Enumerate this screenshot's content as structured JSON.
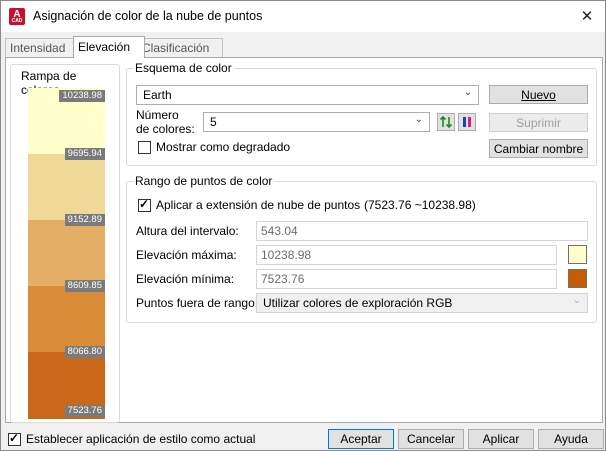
{
  "window": {
    "title": "Asignación de color de la nube de puntos",
    "app_icon_letter": "A",
    "app_icon_caption": "CAD",
    "close_glyph": "✕"
  },
  "tabs": [
    {
      "label": "Intensidad",
      "active": false
    },
    {
      "label": "Elevación",
      "active": true
    },
    {
      "label": "Clasificación",
      "active": false
    }
  ],
  "ramp": {
    "title": "Rampa de colores",
    "colors": [
      "#FFFFCC",
      "#F0D898",
      "#E4AE64",
      "#D88C38",
      "#C86818",
      "#C85C00"
    ],
    "labels": [
      "10238.98",
      "9695.94",
      "9152.89",
      "8609.85",
      "8066.80",
      "7523.76"
    ]
  },
  "color_scheme": {
    "title": "Esquema de color",
    "scheme_value": "Earth",
    "num_colors_label_1": "Número",
    "num_colors_label_2": "de colores:",
    "num_colors_value": "5",
    "show_gradient_label": "Mostrar como degradado",
    "show_gradient_checked": false,
    "new_button": "Nuevo",
    "delete_button": "Suprimir",
    "rename_button": "Cambiar nombre"
  },
  "point_range": {
    "title": "Rango de puntos de color",
    "apply_extent_label": "Aplicar a extensión de nube de puntos",
    "apply_extent_range": "(7523.76 ~10238.98)",
    "apply_extent_checked": true,
    "interval_label": "Altura del intervalo:",
    "interval_value": "543.04",
    "max_label": "Elevación máxima:",
    "max_value": "10238.98",
    "max_color": "#FFFFCC",
    "min_label": "Elevación mínima:",
    "min_value": "7523.76",
    "min_color": "#C85C00",
    "out_of_range_label": "Puntos fuera de rango:",
    "out_of_range_value": "Utilizar colores de exploración RGB"
  },
  "footer": {
    "set_current_label": "Establecer aplicación de estilo como actual",
    "set_current_checked": true,
    "accept": "Aceptar",
    "cancel": "Cancelar",
    "apply": "Aplicar",
    "help": "Ayuda"
  }
}
